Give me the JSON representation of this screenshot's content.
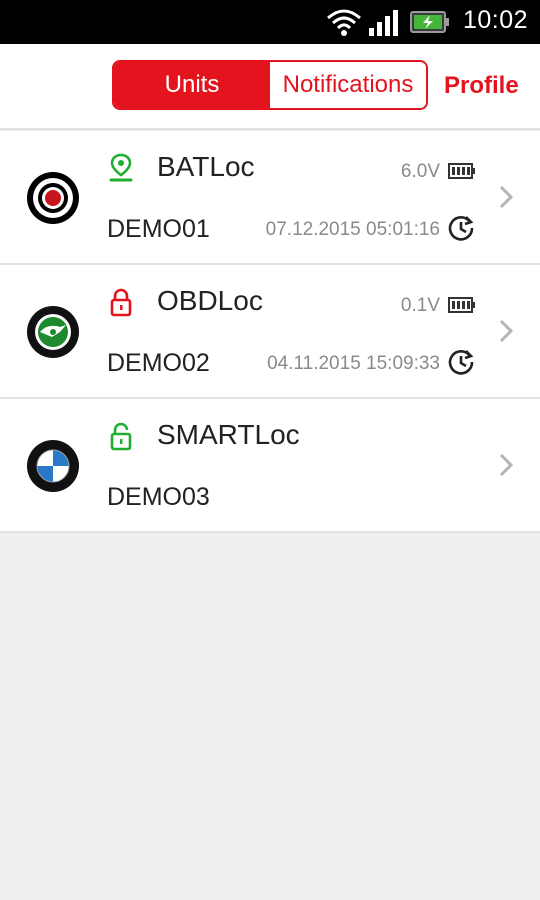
{
  "status_bar": {
    "time": "10:02"
  },
  "tabs": {
    "units": "Units",
    "notifications": "Notifications"
  },
  "profile": "Profile",
  "units": [
    {
      "name": "BATLoc",
      "id": "DEMO01",
      "voltage": "6.0V",
      "timestamp": "07.12.2015 05:01:16",
      "state_icon": "location-pin-icon",
      "logo": "target-logo"
    },
    {
      "name": "OBDLoc",
      "id": "DEMO02",
      "voltage": "0.1V",
      "timestamp": "04.11.2015 15:09:33",
      "state_icon": "lock-closed-icon",
      "logo": "skoda-logo"
    },
    {
      "name": "SMARTLoc",
      "id": "DEMO03",
      "state_icon": "lock-open-icon",
      "logo": "bmw-logo"
    }
  ],
  "colors": {
    "accent": "#e3141e",
    "green": "#1fae2e",
    "text": "#222222",
    "secondary": "#8a8a8a"
  }
}
